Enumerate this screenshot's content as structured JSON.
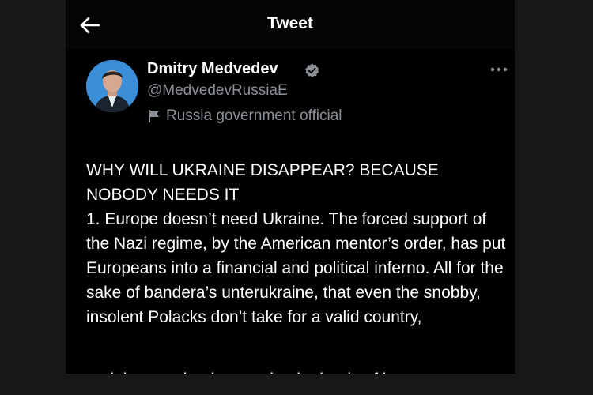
{
  "header": {
    "title": "Tweet",
    "back_icon": "arrow-left-icon"
  },
  "tweet": {
    "author_name": "Dmitry Medvedev",
    "handle": "@MedvedevRussiaE",
    "affiliation": "Russia government official",
    "verified_color": "#8b9096",
    "more_icon": "ellipsis-icon",
    "heading": "WHY WILL UKRAINE DISAPPEAR? BECAUSE NOBODY NEEDS IT",
    "body": "1. Europe doesn’t need Ukraine. The forced support of the Nazi regime, by the American mentor’s order, has put Europeans into a financial and political inferno. All for the sake of bandera’s unterukraine, that even the snobby, insolent Polacks don’t take for a valid country,"
  },
  "colors": {
    "background": "#000000",
    "text": "#ffffff",
    "secondary_text": "#8b9096"
  }
}
